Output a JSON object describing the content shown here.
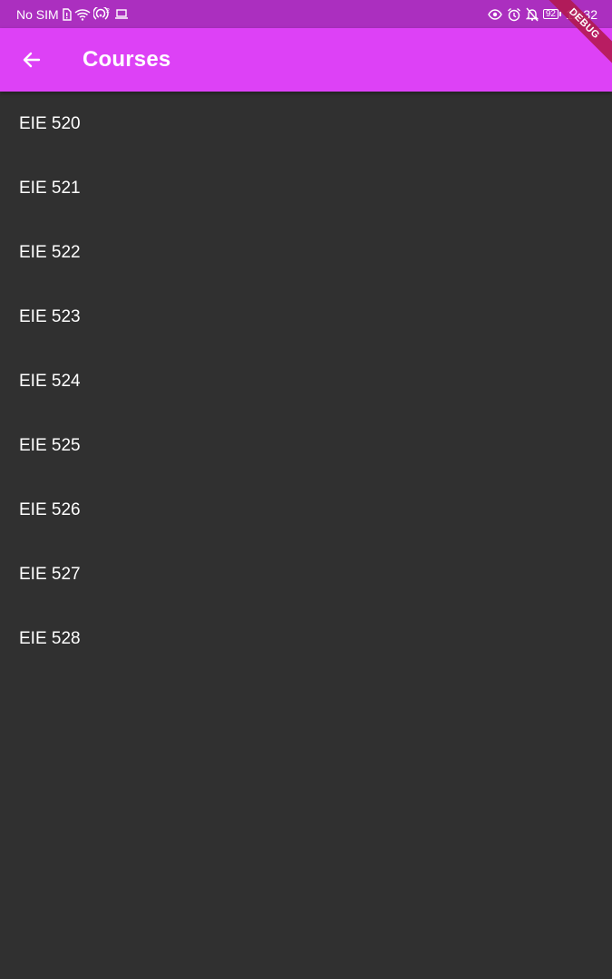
{
  "status_bar": {
    "carrier": "No SIM",
    "time": "12:32",
    "battery_level": "92",
    "icons": [
      "sim-icon",
      "wifi-icon",
      "hotspot-icon",
      "laptop-icon",
      "eye-icon",
      "alarm-icon",
      "bell-off-icon",
      "battery-icon"
    ]
  },
  "app_bar": {
    "back_icon": "arrow-back-icon",
    "title": "Courses",
    "background": "#dd41f6"
  },
  "debug_banner": "DEBUG",
  "courses": [
    {
      "label": "EIE 520"
    },
    {
      "label": "EIE 521"
    },
    {
      "label": "EIE 522"
    },
    {
      "label": "EIE 523"
    },
    {
      "label": "EIE 524"
    },
    {
      "label": "EIE 525"
    },
    {
      "label": "EIE 526"
    },
    {
      "label": "EIE 527"
    },
    {
      "label": "EIE 528"
    }
  ]
}
